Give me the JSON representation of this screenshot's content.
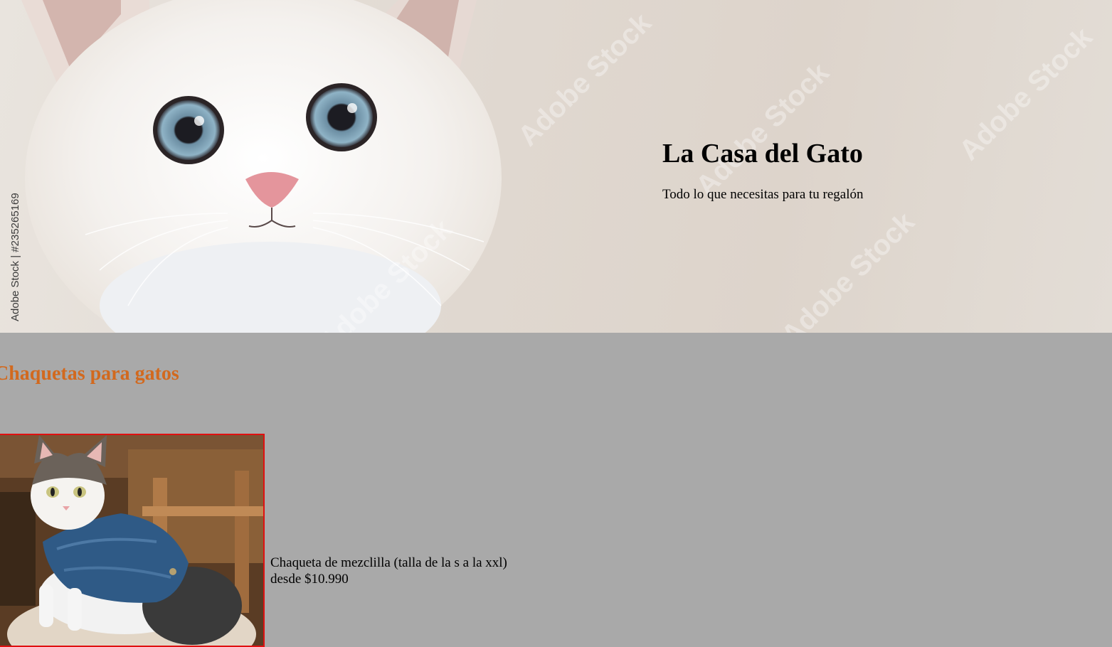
{
  "hero": {
    "title": "La Casa del Gato",
    "tagline": "Todo lo que necesitas para tu regalón",
    "stock_id": "Adobe Stock | #235265169",
    "watermark": "Adobe Stock"
  },
  "section": {
    "title": "Chaquetas para gatos"
  },
  "products": [
    {
      "name": "Chaqueta de mezclilla (talla de la s a la xxl)",
      "price": "desde $10.990"
    }
  ],
  "colors": {
    "page_background": "#a9a9a9",
    "section_title": "#d2691e",
    "product_border": "#e01010"
  }
}
